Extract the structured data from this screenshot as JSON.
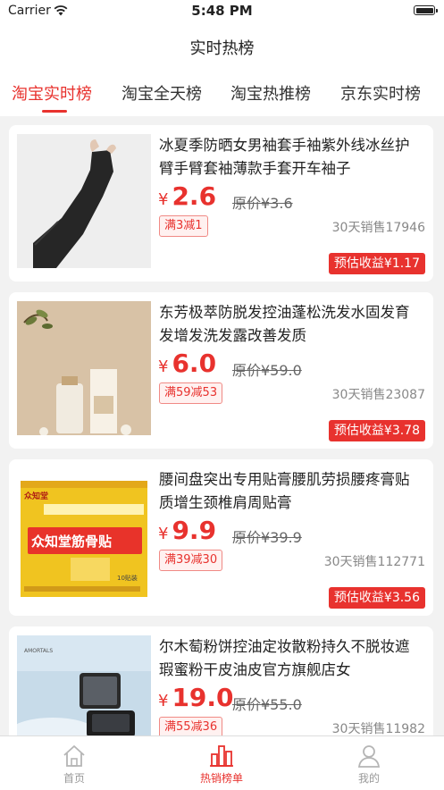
{
  "status": {
    "carrier": "Carrier",
    "time": "5:48 PM"
  },
  "header": {
    "title": "实时热榜"
  },
  "tabs": [
    {
      "label": "淘宝实时榜"
    },
    {
      "label": "淘宝全天榜"
    },
    {
      "label": "淘宝热推榜"
    },
    {
      "label": "京东实时榜"
    }
  ],
  "products": [
    {
      "title": "冰夏季防晒女男袖套手袖紫外线冰丝护臂手臂套袖薄款手套开车袖子",
      "currency": "¥",
      "price": "2.6",
      "original": "原价¥3.6",
      "coupon": "满3减1",
      "sales": "30天销售17946",
      "earning": "预估收益¥1.17",
      "image": "black-arm-sleeve"
    },
    {
      "title": "东芳极萃防脱发控油蓬松洗发水固发育发增发洗发露改善发质",
      "currency": "¥",
      "price": "6.0",
      "original": "原价¥59.0",
      "coupon": "满59减53",
      "sales": "30天销售23087",
      "earning": "预估收益¥3.78",
      "image": "shampoo-bottle"
    },
    {
      "title": "腰间盘突出专用贴膏腰肌劳损腰疼膏贴质增生颈椎肩周贴膏",
      "currency": "¥",
      "price": "9.9",
      "original": "原价¥39.9",
      "coupon": "满39减30",
      "sales": "30天销售112771",
      "earning": "预估收益¥3.56",
      "image": "plaster-box",
      "image_text": {
        "brand": "众知堂",
        "product": "众知堂筋骨贴",
        "count": "10贴装"
      }
    },
    {
      "title": "尔木萄粉饼控油定妆散粉持久不脱妆遮瑕蜜粉干皮油皮官方旗舰店女",
      "currency": "¥",
      "price": "19.0",
      "original": "原价¥55.0",
      "coupon": "满55减36",
      "sales": "30天销售11982",
      "earning": "",
      "image": "powder-compact",
      "image_text": {
        "brand": "AMORTALS"
      }
    }
  ],
  "tabbar": [
    {
      "label": "首页",
      "icon": "home-icon"
    },
    {
      "label": "热销榜单",
      "icon": "rank-chart-icon"
    },
    {
      "label": "我的",
      "icon": "user-icon"
    }
  ],
  "colors": {
    "accent": "#e8322e",
    "background": "#f2f2f2"
  }
}
